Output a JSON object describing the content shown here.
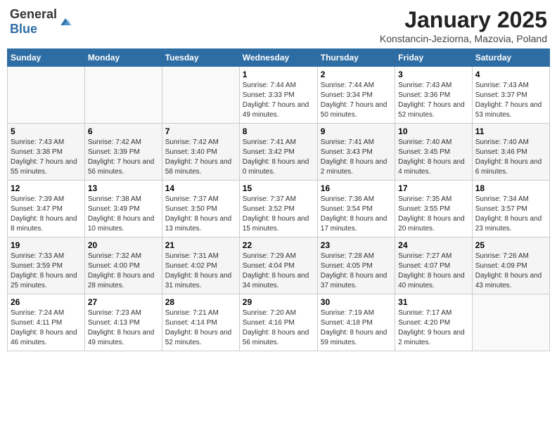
{
  "header": {
    "logo_general": "General",
    "logo_blue": "Blue",
    "month_title": "January 2025",
    "subtitle": "Konstancin-Jeziorna, Mazovia, Poland"
  },
  "weekdays": [
    "Sunday",
    "Monday",
    "Tuesday",
    "Wednesday",
    "Thursday",
    "Friday",
    "Saturday"
  ],
  "weeks": [
    [
      {
        "day": "",
        "info": ""
      },
      {
        "day": "",
        "info": ""
      },
      {
        "day": "",
        "info": ""
      },
      {
        "day": "1",
        "info": "Sunrise: 7:44 AM\nSunset: 3:33 PM\nDaylight: 7 hours and 49 minutes."
      },
      {
        "day": "2",
        "info": "Sunrise: 7:44 AM\nSunset: 3:34 PM\nDaylight: 7 hours and 50 minutes."
      },
      {
        "day": "3",
        "info": "Sunrise: 7:43 AM\nSunset: 3:36 PM\nDaylight: 7 hours and 52 minutes."
      },
      {
        "day": "4",
        "info": "Sunrise: 7:43 AM\nSunset: 3:37 PM\nDaylight: 7 hours and 53 minutes."
      }
    ],
    [
      {
        "day": "5",
        "info": "Sunrise: 7:43 AM\nSunset: 3:38 PM\nDaylight: 7 hours and 55 minutes."
      },
      {
        "day": "6",
        "info": "Sunrise: 7:42 AM\nSunset: 3:39 PM\nDaylight: 7 hours and 56 minutes."
      },
      {
        "day": "7",
        "info": "Sunrise: 7:42 AM\nSunset: 3:40 PM\nDaylight: 7 hours and 58 minutes."
      },
      {
        "day": "8",
        "info": "Sunrise: 7:41 AM\nSunset: 3:42 PM\nDaylight: 8 hours and 0 minutes."
      },
      {
        "day": "9",
        "info": "Sunrise: 7:41 AM\nSunset: 3:43 PM\nDaylight: 8 hours and 2 minutes."
      },
      {
        "day": "10",
        "info": "Sunrise: 7:40 AM\nSunset: 3:45 PM\nDaylight: 8 hours and 4 minutes."
      },
      {
        "day": "11",
        "info": "Sunrise: 7:40 AM\nSunset: 3:46 PM\nDaylight: 8 hours and 6 minutes."
      }
    ],
    [
      {
        "day": "12",
        "info": "Sunrise: 7:39 AM\nSunset: 3:47 PM\nDaylight: 8 hours and 8 minutes."
      },
      {
        "day": "13",
        "info": "Sunrise: 7:38 AM\nSunset: 3:49 PM\nDaylight: 8 hours and 10 minutes."
      },
      {
        "day": "14",
        "info": "Sunrise: 7:37 AM\nSunset: 3:50 PM\nDaylight: 8 hours and 13 minutes."
      },
      {
        "day": "15",
        "info": "Sunrise: 7:37 AM\nSunset: 3:52 PM\nDaylight: 8 hours and 15 minutes."
      },
      {
        "day": "16",
        "info": "Sunrise: 7:36 AM\nSunset: 3:54 PM\nDaylight: 8 hours and 17 minutes."
      },
      {
        "day": "17",
        "info": "Sunrise: 7:35 AM\nSunset: 3:55 PM\nDaylight: 8 hours and 20 minutes."
      },
      {
        "day": "18",
        "info": "Sunrise: 7:34 AM\nSunset: 3:57 PM\nDaylight: 8 hours and 23 minutes."
      }
    ],
    [
      {
        "day": "19",
        "info": "Sunrise: 7:33 AM\nSunset: 3:59 PM\nDaylight: 8 hours and 25 minutes."
      },
      {
        "day": "20",
        "info": "Sunrise: 7:32 AM\nSunset: 4:00 PM\nDaylight: 8 hours and 28 minutes."
      },
      {
        "day": "21",
        "info": "Sunrise: 7:31 AM\nSunset: 4:02 PM\nDaylight: 8 hours and 31 minutes."
      },
      {
        "day": "22",
        "info": "Sunrise: 7:29 AM\nSunset: 4:04 PM\nDaylight: 8 hours and 34 minutes."
      },
      {
        "day": "23",
        "info": "Sunrise: 7:28 AM\nSunset: 4:05 PM\nDaylight: 8 hours and 37 minutes."
      },
      {
        "day": "24",
        "info": "Sunrise: 7:27 AM\nSunset: 4:07 PM\nDaylight: 8 hours and 40 minutes."
      },
      {
        "day": "25",
        "info": "Sunrise: 7:26 AM\nSunset: 4:09 PM\nDaylight: 8 hours and 43 minutes."
      }
    ],
    [
      {
        "day": "26",
        "info": "Sunrise: 7:24 AM\nSunset: 4:11 PM\nDaylight: 8 hours and 46 minutes."
      },
      {
        "day": "27",
        "info": "Sunrise: 7:23 AM\nSunset: 4:13 PM\nDaylight: 8 hours and 49 minutes."
      },
      {
        "day": "28",
        "info": "Sunrise: 7:21 AM\nSunset: 4:14 PM\nDaylight: 8 hours and 52 minutes."
      },
      {
        "day": "29",
        "info": "Sunrise: 7:20 AM\nSunset: 4:16 PM\nDaylight: 8 hours and 56 minutes."
      },
      {
        "day": "30",
        "info": "Sunrise: 7:19 AM\nSunset: 4:18 PM\nDaylight: 8 hours and 59 minutes."
      },
      {
        "day": "31",
        "info": "Sunrise: 7:17 AM\nSunset: 4:20 PM\nDaylight: 9 hours and 2 minutes."
      },
      {
        "day": "",
        "info": ""
      }
    ]
  ]
}
